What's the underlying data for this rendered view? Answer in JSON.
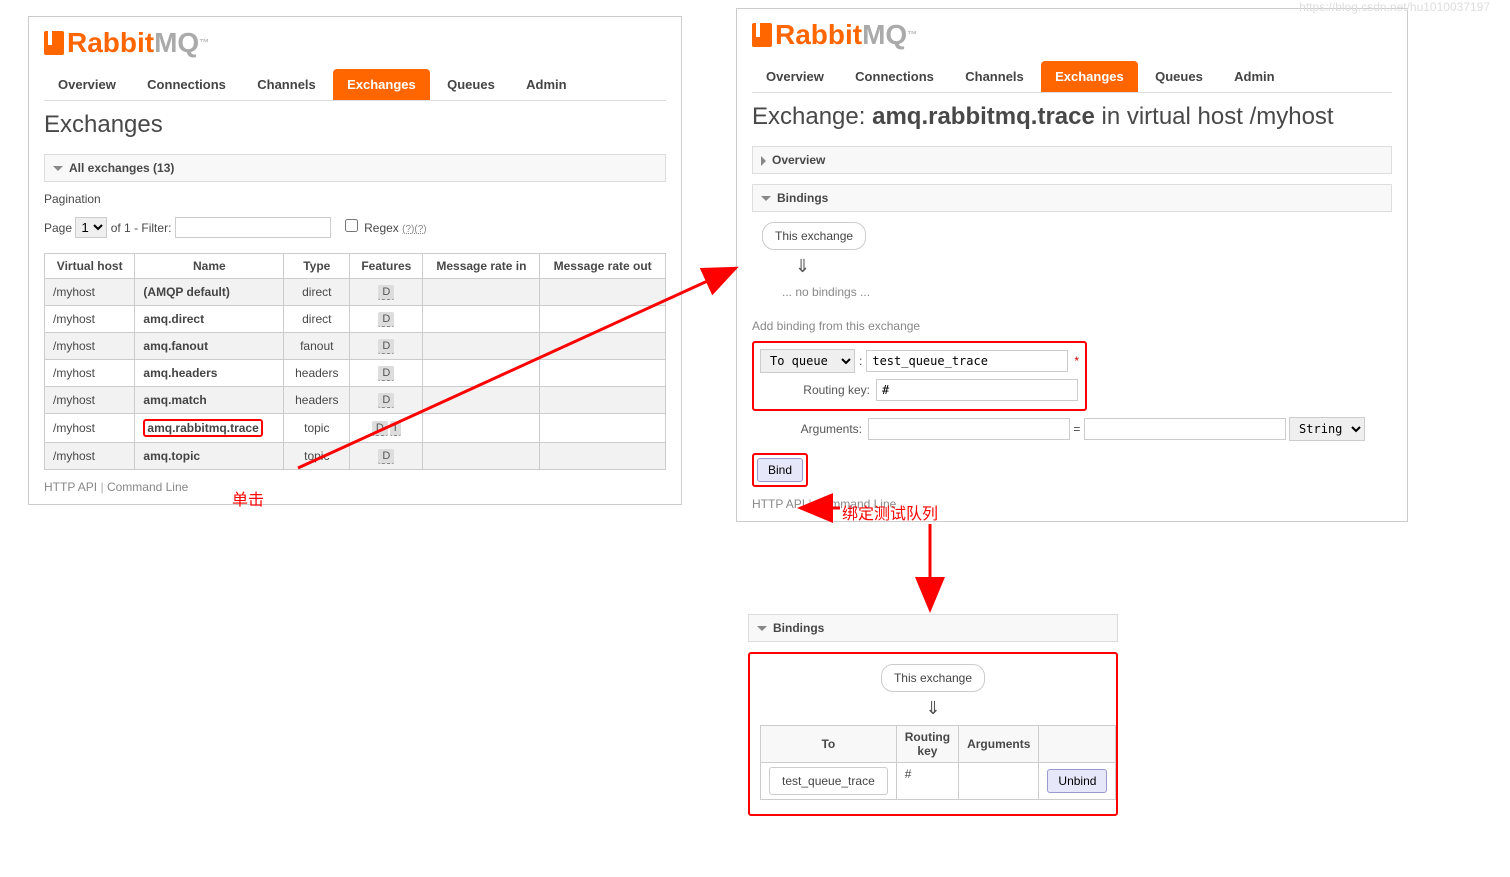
{
  "logo": {
    "a": "Rabbit",
    "b": "MQ",
    "tm": "™"
  },
  "tabs": [
    "Overview",
    "Connections",
    "Channels",
    "Exchanges",
    "Queues",
    "Admin"
  ],
  "left": {
    "title": "Exchanges",
    "section_all": "All exchanges (13)",
    "pagination": {
      "heading": "Pagination",
      "page_label": "Page",
      "page_value": "1",
      "of_text": "of 1  - Filter:",
      "regex_label": "Regex",
      "regex_sup": "(?)(?)"
    },
    "headers": [
      "Virtual host",
      "Name",
      "Type",
      "Features",
      "Message rate in",
      "Message rate out"
    ],
    "rows": [
      {
        "vhost": "/myhost",
        "name": "(AMQP default)",
        "type": "direct",
        "feat": [
          "D"
        ]
      },
      {
        "vhost": "/myhost",
        "name": "amq.direct",
        "type": "direct",
        "feat": [
          "D"
        ]
      },
      {
        "vhost": "/myhost",
        "name": "amq.fanout",
        "type": "fanout",
        "feat": [
          "D"
        ]
      },
      {
        "vhost": "/myhost",
        "name": "amq.headers",
        "type": "headers",
        "feat": [
          "D"
        ]
      },
      {
        "vhost": "/myhost",
        "name": "amq.match",
        "type": "headers",
        "feat": [
          "D"
        ]
      },
      {
        "vhost": "/myhost",
        "name": "amq.rabbitmq.trace",
        "type": "topic",
        "feat": [
          "D",
          "I"
        ]
      },
      {
        "vhost": "/myhost",
        "name": "amq.topic",
        "type": "topic",
        "feat": [
          "D"
        ]
      }
    ],
    "footer": {
      "http_api": "HTTP API",
      "cmdline": "Command Line"
    }
  },
  "right": {
    "title_prefix": "Exchange: ",
    "title_name": "amq.rabbitmq.trace",
    "title_mid": " in virtual host ",
    "title_vhost": "/myhost",
    "overview_section": "Overview",
    "bindings_section": "Bindings",
    "this_exchange": "This exchange",
    "no_bindings": "... no bindings ...",
    "add_binding_label": "Add binding from this exchange",
    "target_select": "To queue",
    "target_value": "test_queue_trace",
    "routing_key_label": "Routing key:",
    "routing_key_value": "#",
    "arguments_label": "Arguments:",
    "arg_eq": "=",
    "arg_type": "String",
    "bind_button": "Bind",
    "footer": {
      "http_api": "HTTP API",
      "cmdline": "Command Line"
    }
  },
  "bottom": {
    "bindings_section": "Bindings",
    "this_exchange": "This exchange",
    "headers": [
      "To",
      "Routing key",
      "Arguments",
      ""
    ],
    "row": {
      "to": "test_queue_trace",
      "rk": "#",
      "args": "",
      "unbind": "Unbind"
    }
  },
  "annotations": {
    "click": "单击",
    "bind_queue": "绑定测试队列"
  },
  "watermark": "https://blog.csdn.net/hu1010037197"
}
